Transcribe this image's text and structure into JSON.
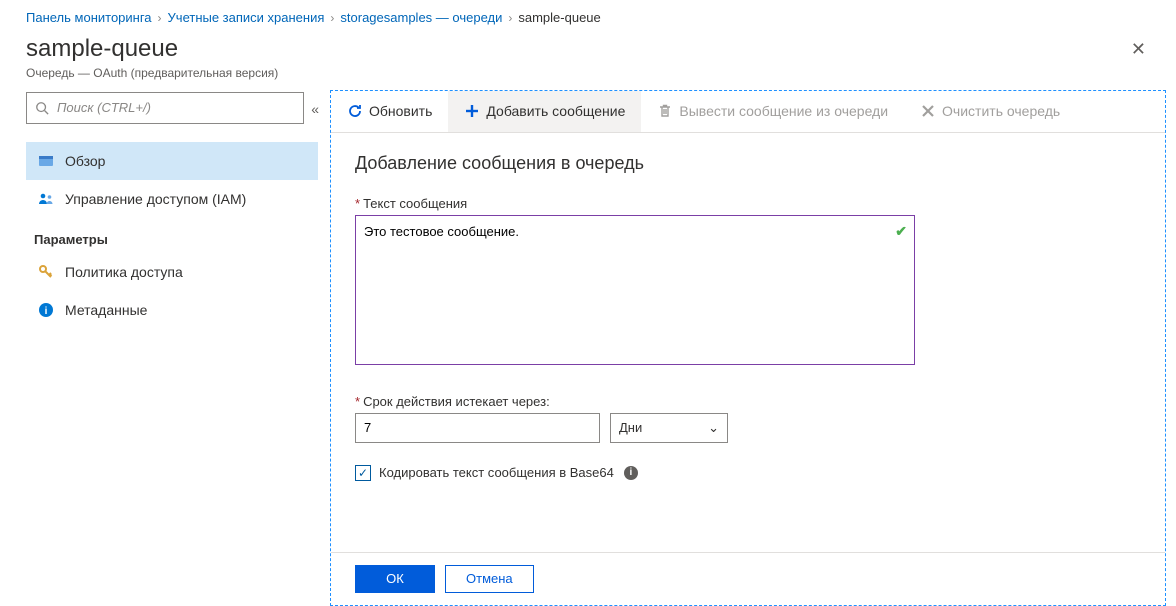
{
  "breadcrumb": {
    "items": [
      {
        "label": "Панель мониторинга",
        "link": true
      },
      {
        "label": "Учетные записи хранения",
        "link": true
      },
      {
        "label": "storagesamples — очереди",
        "link": true
      },
      {
        "label": "sample-queue",
        "link": false
      }
    ]
  },
  "header": {
    "title": "sample-queue",
    "subtitle": "Очередь — OAuth (предварительная версия)"
  },
  "sidebar": {
    "search_placeholder": "Поиск (CTRL+/)",
    "nav": [
      {
        "label": "Обзор",
        "icon": "overview"
      },
      {
        "label": "Управление доступом (IAM)",
        "icon": "iam"
      }
    ],
    "section_title": "Параметры",
    "section_items": [
      {
        "label": "Политика доступа",
        "icon": "key"
      },
      {
        "label": "Метаданные",
        "icon": "info"
      }
    ]
  },
  "toolbar": {
    "refresh": "Обновить",
    "add": "Добавить сообщение",
    "dequeue": "Вывести сообщение из очереди",
    "clear": "Очистить очередь"
  },
  "form": {
    "heading": "Добавление сообщения в очередь",
    "msg_label": "Текст сообщения",
    "msg_value": "Это тестовое сообщение.",
    "expires_label": "Срок действия истекает через:",
    "expires_value": "7",
    "expires_unit": "Дни",
    "encode_label": "Кодировать текст сообщения в Base64",
    "encode_checked": true
  },
  "footer": {
    "ok": "ОК",
    "cancel": "Отмена"
  }
}
